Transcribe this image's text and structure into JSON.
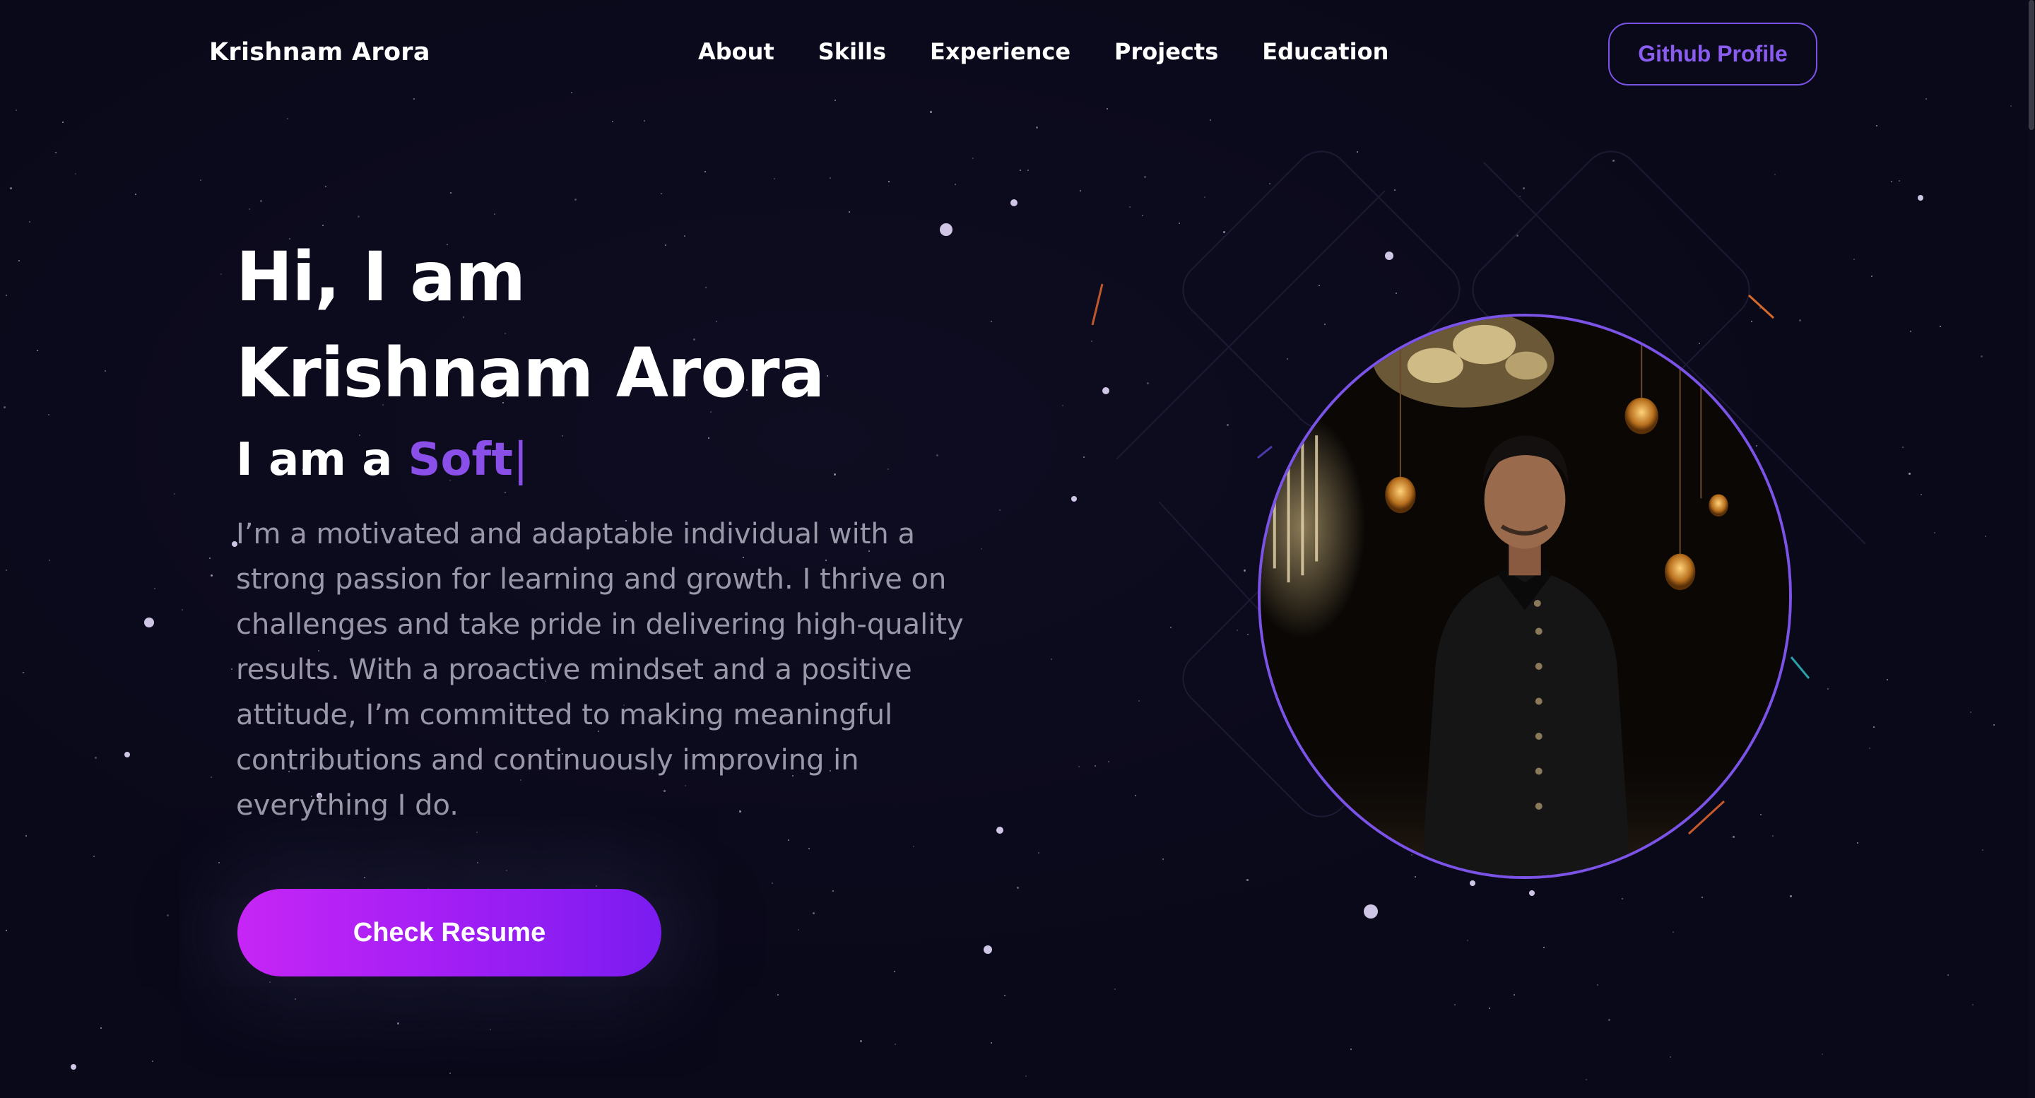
{
  "nav": {
    "brand": "Krishnam Arora",
    "links": [
      "About",
      "Skills",
      "Experience",
      "Projects",
      "Education"
    ],
    "github_label": "Github Profile"
  },
  "hero": {
    "greeting": "Hi, I am",
    "name": "Krishnam Arora",
    "role_prefix": "I am a",
    "role_typed": "Soft",
    "cursor": "|",
    "bio": "I’m a motivated and adaptable individual with a strong passion for learning and growth. I thrive on challenges and take pride in delivering high-quality results. With a proactive mindset and a positive attitude, I’m committed to making meaningful contributions and continuously improving in everything I do.",
    "resume_label": "Check Resume"
  },
  "colors": {
    "accent": "#8a4fe8",
    "button_gradient_start": "#c626f5",
    "button_gradient_end": "#7a1cf0",
    "background": "#0a0919"
  }
}
